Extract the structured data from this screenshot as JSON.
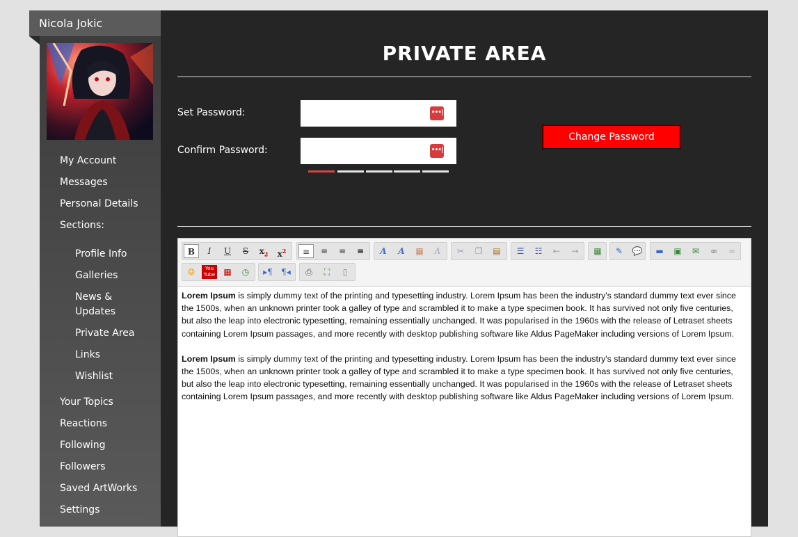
{
  "user": {
    "name": "Nicola Jokic"
  },
  "nav": {
    "top": [
      "My Account",
      "Messages",
      "Personal Details",
      "Sections:"
    ],
    "sections": [
      "Profile Info",
      "Galleries",
      "News &",
      "Updates",
      "Private Area",
      "Links",
      "Wishlist"
    ],
    "bottom": [
      "Your Topics",
      "Reactions",
      "Following",
      "Followers",
      "Saved ArtWorks",
      "Settings"
    ]
  },
  "page": {
    "title": "PRIVATE AREA"
  },
  "form": {
    "set_password_label": "Set Password:",
    "confirm_password_label": "Confirm Password:",
    "change_button": "Change Password",
    "password_strength": 0.2
  },
  "editor": {
    "toolbar_icons": [
      "bold-icon",
      "italic-icon",
      "underline-icon",
      "strikethrough-icon",
      "subscript-icon",
      "superscript-icon",
      "align-left-icon",
      "align-center-icon",
      "align-right-icon",
      "justify-icon",
      "font-icon",
      "font-size-icon",
      "color-icon",
      "clear-format-icon",
      "cut-icon",
      "copy-icon",
      "paste-icon",
      "bullet-list-icon",
      "numbered-list-icon",
      "outdent-icon",
      "indent-icon",
      "insert-table-icon",
      "spellcheck-icon",
      "comment-icon",
      "horizontal-rule-icon",
      "image-icon",
      "email-icon",
      "link-icon",
      "unlink-icon",
      "emoji-icon",
      "youtube-icon",
      "date-icon",
      "time-icon",
      "ltr-icon",
      "rtl-icon",
      "print-icon",
      "fullscreen-icon",
      "source-icon"
    ],
    "paragraphs": [
      {
        "bold": "Lorem Ipsum",
        "text": " is simply dummy text of the printing and typesetting industry. Lorem Ipsum has been the industry's standard dummy text ever since the 1500s, when an unknown printer took a galley of type and scrambled it to make a type specimen book. It has survived not only five centuries, but also the leap into electronic typesetting, remaining essentially unchanged. It was popularised in the 1960s with the release of Letraset sheets containing Lorem Ipsum passages, and more recently with desktop publishing software like Aldus PageMaker including versions of Lorem Ipsum."
      },
      {
        "bold": "Lorem Ipsum",
        "text": " is simply dummy text of the printing and typesetting industry. Lorem Ipsum has been the industry's standard dummy text ever since the 1500s, when an unknown printer took a galley of type and scrambled it to make a type specimen book. It has survived not only five centuries, but also the leap into electronic typesetting, remaining essentially unchanged. It was popularised in the 1960s with the release of Letraset sheets containing Lorem Ipsum passages, and more recently with desktop publishing software like Aldus PageMaker including versions of Lorem Ipsum."
      }
    ]
  },
  "colors": {
    "accent": "#ff0000",
    "panel": "#252525",
    "sidebar": "#4a4a4a"
  }
}
